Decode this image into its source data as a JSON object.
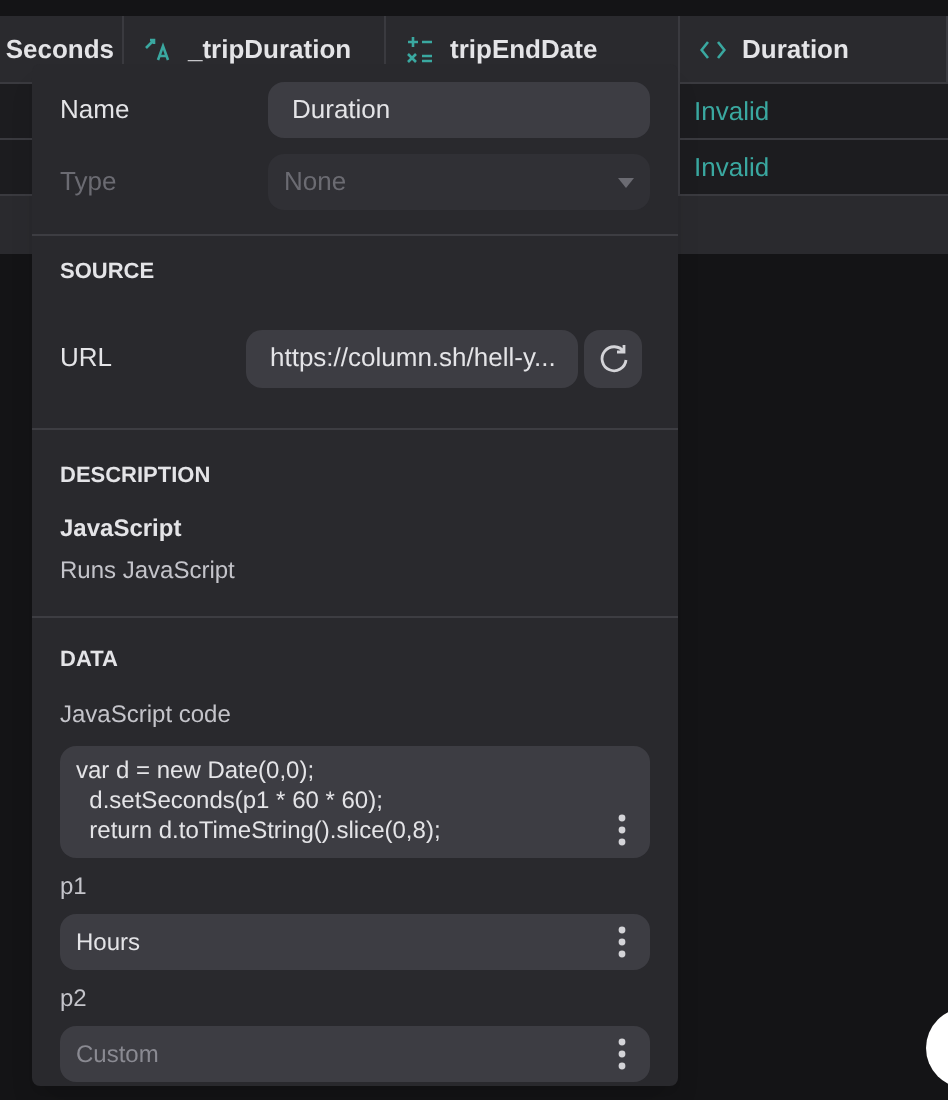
{
  "table": {
    "columns": [
      {
        "label": "Seconds",
        "kind": "plain"
      },
      {
        "label": "_tripDuration",
        "kind": "text"
      },
      {
        "label": "tripEndDate",
        "kind": "formula"
      },
      {
        "label": "Duration",
        "kind": "code"
      }
    ],
    "rows": [
      {
        "column_4": "Invalid"
      },
      {
        "column_4": "Invalid"
      }
    ]
  },
  "popover": {
    "name": {
      "label": "Name",
      "value": "Duration"
    },
    "type": {
      "label": "Type",
      "value": "None",
      "disabled": true
    },
    "source": {
      "heading": "SOURCE",
      "url_label": "URL",
      "url": "https://column.sh/hell-y..."
    },
    "description": {
      "heading": "DESCRIPTION",
      "title": "JavaScript",
      "text": "Runs JavaScript"
    },
    "data": {
      "heading": "DATA",
      "params": [
        {
          "label": "JavaScript code",
          "kind": "code",
          "value": "var d = new Date(0,0);\n  d.setSeconds(p1 * 60 * 60);\n  return d.toTimeString().slice(0,8);"
        },
        {
          "label": "p1",
          "kind": "select",
          "value": "Hours"
        },
        {
          "label": "p2",
          "kind": "select",
          "placeholder": "Custom"
        }
      ]
    }
  }
}
